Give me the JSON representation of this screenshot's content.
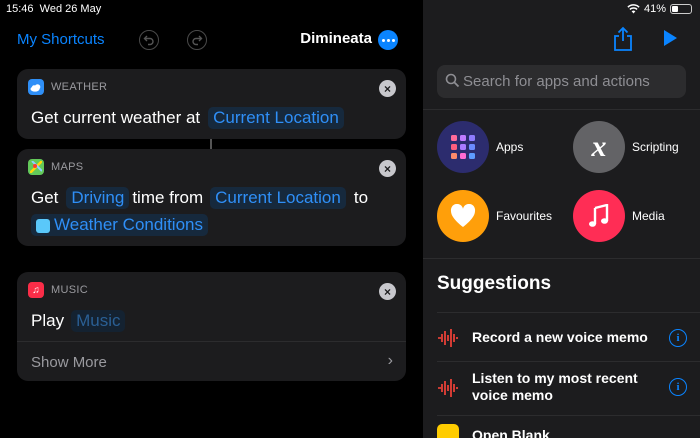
{
  "status": {
    "time": "15:46",
    "date": "Wed 26 May",
    "battery": "41%",
    "battery_level": 0.41
  },
  "nav": {
    "back_label": "My Shortcuts",
    "title": "Dimineata"
  },
  "actions": [
    {
      "app": "WEATHER",
      "icon": "weather-icon",
      "color": "#2f8ff7",
      "parts": {
        "text1": "Get current weather at",
        "token1": "Current Location"
      }
    },
    {
      "app": "MAPS",
      "icon": "maps-icon",
      "color": "#63c95a",
      "parts": {
        "text1": "Get",
        "token1": "Driving",
        "text2": "time from",
        "token2": "Current Location",
        "text3": "to",
        "token3": "Weather Conditions"
      }
    },
    {
      "app": "MUSIC",
      "icon": "music-icon",
      "color": "#fa2d48",
      "parts": {
        "text1": "Play",
        "token1": "Music"
      },
      "show_more": "Show More"
    }
  ],
  "search": {
    "placeholder": "Search for apps and actions"
  },
  "categories": [
    {
      "label": "Apps",
      "icon": "apps-grid-icon",
      "color": "#2c2c6e"
    },
    {
      "label": "Scripting",
      "icon": "scripting-x-icon",
      "color": "#636366"
    },
    {
      "label": "Favourites",
      "icon": "heart-icon",
      "color": "#ff9f0a"
    },
    {
      "label": "Media",
      "icon": "music-note-icon",
      "color": "#ff2d55"
    }
  ],
  "suggestions": {
    "title": "Suggestions",
    "items": [
      {
        "label": "Record a new voice memo",
        "icon": "voice-memo-icon"
      },
      {
        "label_line1": "Listen to my most recent",
        "label_line2": "voice memo",
        "icon": "voice-memo-icon"
      },
      {
        "label": "Open Blank",
        "icon": "notes-icon"
      }
    ]
  },
  "colors": {
    "accent": "#0a84ff",
    "card": "#1c1c1e",
    "token": "#2f8ff7"
  }
}
